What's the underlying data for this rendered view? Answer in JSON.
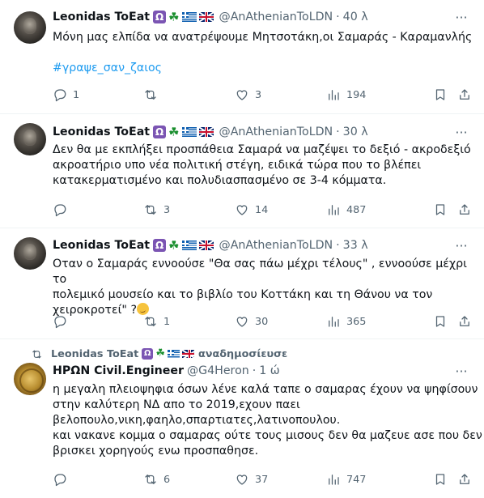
{
  "tweets": [
    {
      "name": "Leonidas ToEat",
      "ophi": "Ω",
      "clover": "☘",
      "handle": "@AnAthenianToLDN",
      "time": "40 λ",
      "lines": [
        "Μόνη μας ελπίδα να ανατρέψουμε Μητσοτάκη,οι Σαμαράς - Καραμανλής"
      ],
      "hashtag": "#γραψε_σαν_ζαιος",
      "replies": "1",
      "retweets": "",
      "likes": "3",
      "views": "194"
    },
    {
      "name": "Leonidas ToEat",
      "ophi": "Ω",
      "clover": "☘",
      "handle": "@AnAthenianToLDN",
      "time": "30 λ",
      "lines": [
        "Δεν θα με εκπλήξει προσπάθεια Σαμαρά να μαζέψει το δεξιό - ακροδεξιό",
        "ακροατήριο υπο νέα πολιτική στέγη, ειδικά τώρα που το βλέπει",
        "κατακερματισμένο και πολυδιασπασμένο σε 3-4 κόμματα."
      ],
      "replies": "",
      "retweets": "3",
      "likes": "14",
      "views": "487"
    },
    {
      "name": "Leonidas ToEat",
      "ophi": "Ω",
      "clover": "☘",
      "handle": "@AnAthenianToLDN",
      "time": "33 λ",
      "lines": [
        "Οταν ο Σαμαράς εννοούσε \"Θα σας πάω μέχρι τέλους\" , εννοούσε μέχρι το",
        "πολεμικό μουσείο και το βιβλίο του Κοττάκη και τη Θάνου να τον",
        "χειροκροτεί\" ?"
      ],
      "replies": "",
      "retweets": "1",
      "likes": "30",
      "views": "365"
    },
    {
      "retweet_context": "Leonidas ToEat",
      "retweet_ophi": "Ω",
      "retweet_clover": "☘",
      "retweet_action": "αναδημοσίευσε",
      "name": "ΗΡΩΝ Civil.Engineer",
      "handle": "@G4Heron",
      "time": "1 ώ",
      "lines": [
        "η μεγαλη πλειοψηφια όσων λένε καλά ταπε ο σαμαρας έχουν να ψηφίσουν",
        "στην καλύτερη ΝΔ απο το 2019,εχουν παει",
        "βελοπουλο,νικη,φαηλο,σπαρτιατες,λατινοπουλου.",
        "και νακανε κομμα ο σαμαρας ούτε τους μισους δεν θα μαζευε ασε που δεν",
        "βρισκει χορηγούς ενω προσπαθησε."
      ],
      "replies": "",
      "retweets": "6",
      "likes": "37",
      "views": "747"
    }
  ],
  "colors": {
    "text": "#0f1419",
    "secondary": "#536471",
    "link": "#1d9bf0",
    "divider": "#eff3f4"
  },
  "icons": [
    "reply-icon",
    "retweet-icon",
    "like-icon",
    "views-icon",
    "bookmark-icon",
    "share-icon",
    "more-icon"
  ]
}
